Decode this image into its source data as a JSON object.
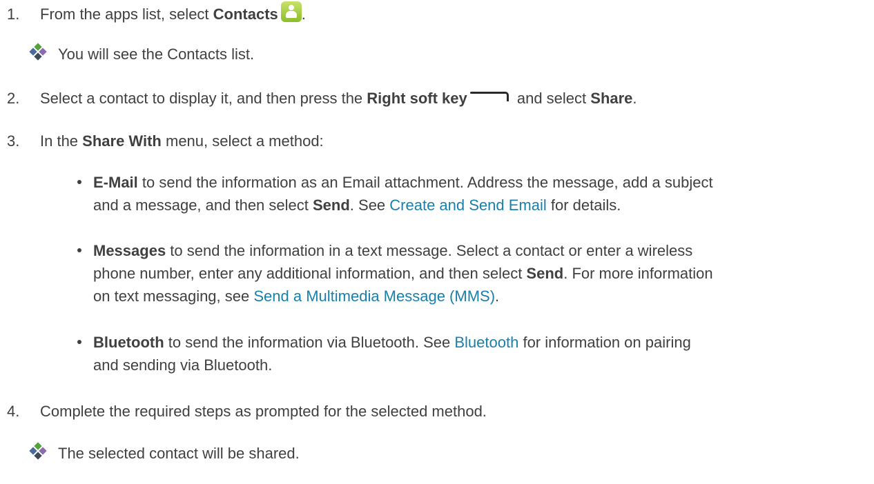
{
  "steps": [
    {
      "number": "1.",
      "before": "From the apps list, select ",
      "bold": "Contacts",
      "icon": "contacts-app-icon",
      "after": ".",
      "result": "You will see the Contacts list."
    },
    {
      "number": "2.",
      "before": "Select a contact to display it, and then press the ",
      "bold": "Right soft key",
      "icon": "right-soft-key-icon",
      "middle": " and select ",
      "bold2": "Share",
      "after": "."
    },
    {
      "number": "3.",
      "before": "In the ",
      "bold": "Share With",
      "after": " menu, select a method:",
      "options": [
        {
          "bold": "E-Mail",
          "line1": " to send the information as an Email attachment. Address the message, add a subject",
          "line2a": "and a message, and then select ",
          "bold2": "Send",
          "line2b": ". See ",
          "link": "Create and Send Email",
          "line2c": " for details."
        },
        {
          "bold": "Messages",
          "line1": " to send the information in a text message. Select a contact or enter a wireless",
          "line2a": "phone number, enter any additional information, and then select ",
          "bold2": "Send",
          "line2b": ". For more information",
          "line3a": "on text messaging, see ",
          "link": "Send a Multimedia Message (MMS)",
          "line3b": "."
        },
        {
          "bold": "Bluetooth",
          "line1a": " to send the information via Bluetooth. See ",
          "link": "Bluetooth",
          "line1b": " for information on pairing",
          "line2": "and sending via Bluetooth."
        }
      ]
    },
    {
      "number": "4.",
      "text": "Complete the required steps as prompted for the selected method.",
      "result": "The selected contact will be shared."
    }
  ],
  "result_icon": "diamond-bullet-icon",
  "colors": {
    "text": "#404040",
    "link": "#1a7fab",
    "contacts_icon": "#9ccb3a"
  }
}
